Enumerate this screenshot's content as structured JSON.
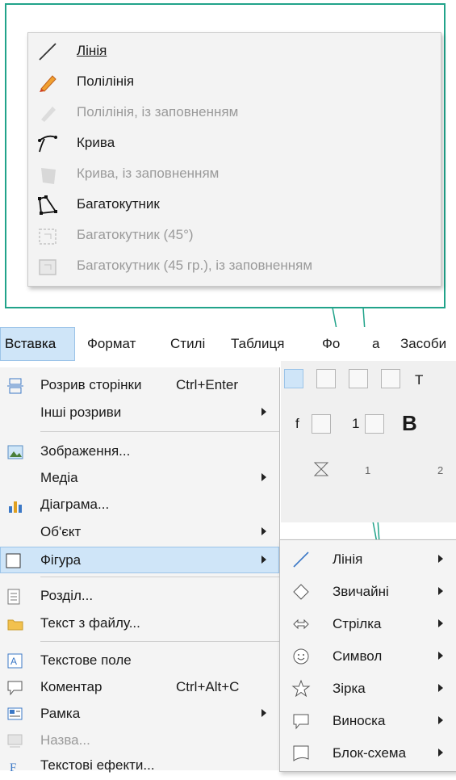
{
  "line_submenu": {
    "items": [
      {
        "label": "Лінія",
        "icon": "line-icon",
        "enabled": true
      },
      {
        "label": "Полілінія",
        "icon": "polyline-icon",
        "enabled": true
      },
      {
        "label": "Полілінія, із заповненням",
        "icon": "polyline-filled-icon",
        "enabled": false
      },
      {
        "label": "Крива",
        "icon": "curve-icon",
        "enabled": true
      },
      {
        "label": "Крива, із заповненням",
        "icon": "curve-filled-icon",
        "enabled": false
      },
      {
        "label": "Багатокутник",
        "icon": "polygon-icon",
        "enabled": true
      },
      {
        "label": "Багатокутник (45°)",
        "icon": "polygon-45-icon",
        "enabled": false
      },
      {
        "label": "Багатокутник (45 гр.), із заповненням",
        "icon": "polygon-45-filled-icon",
        "enabled": false
      }
    ]
  },
  "menubar": {
    "items": [
      "Вставка",
      "Формат",
      "Стилі",
      "Таблиця",
      "Фо",
      "а",
      "Засоби"
    ]
  },
  "toolbar": {
    "font_fragment": "f",
    "size_fragment": "1",
    "bold": "B",
    "style_fragment": "T",
    "ruler_1": "1",
    "ruler_2": "2"
  },
  "insert_menu": {
    "items": [
      {
        "label": "Розрив сторінки",
        "shortcut": "Ctrl+Enter",
        "icon": "page-break-icon",
        "submenu": false,
        "enabled": true
      },
      {
        "label": "Інші розриви",
        "shortcut": "",
        "icon": "",
        "submenu": true,
        "enabled": true
      },
      {
        "label": "Зображення...",
        "shortcut": "",
        "icon": "image-icon",
        "submenu": false,
        "enabled": true
      },
      {
        "label": "Медіа",
        "shortcut": "",
        "icon": "",
        "submenu": true,
        "enabled": true
      },
      {
        "label": "Діаграма...",
        "shortcut": "",
        "icon": "chart-icon",
        "submenu": false,
        "enabled": true
      },
      {
        "label": "Об'єкт",
        "shortcut": "",
        "icon": "",
        "submenu": true,
        "enabled": true
      },
      {
        "label": "Фігура",
        "shortcut": "",
        "icon": "shape-icon",
        "submenu": true,
        "enabled": true
      },
      {
        "label": "Розділ...",
        "shortcut": "",
        "icon": "section-icon",
        "submenu": false,
        "enabled": true
      },
      {
        "label": "Текст з файлу...",
        "shortcut": "",
        "icon": "folder-icon",
        "submenu": false,
        "enabled": true
      },
      {
        "label": "Текстове поле",
        "shortcut": "",
        "icon": "text-box-icon",
        "submenu": false,
        "enabled": true
      },
      {
        "label": "Коментар",
        "shortcut": "Ctrl+Alt+C",
        "icon": "comment-icon",
        "submenu": false,
        "enabled": true
      },
      {
        "label": "Рамка",
        "shortcut": "",
        "icon": "frame-icon",
        "submenu": true,
        "enabled": true
      },
      {
        "label": "Назва...",
        "shortcut": "",
        "icon": "caption-icon",
        "submenu": false,
        "enabled": false
      },
      {
        "label": "Текстові ефекти...",
        "shortcut": "",
        "icon": "fontwork-icon",
        "submenu": false,
        "enabled": true
      }
    ]
  },
  "shape_submenu": {
    "items": [
      {
        "label": "Лінія",
        "icon": "line-icon"
      },
      {
        "label": "Звичайні",
        "icon": "diamond-icon"
      },
      {
        "label": "Стрілка",
        "icon": "arrow-icon"
      },
      {
        "label": "Символ",
        "icon": "smiley-icon"
      },
      {
        "label": "Зірка",
        "icon": "star-icon"
      },
      {
        "label": "Виноска",
        "icon": "callout-icon"
      },
      {
        "label": "Блок-схема",
        "icon": "flowchart-icon"
      }
    ]
  },
  "colors": {
    "accent": "#21a38a",
    "highlight": "#cfe5f8",
    "disabled_text": "#9a9a9a"
  }
}
